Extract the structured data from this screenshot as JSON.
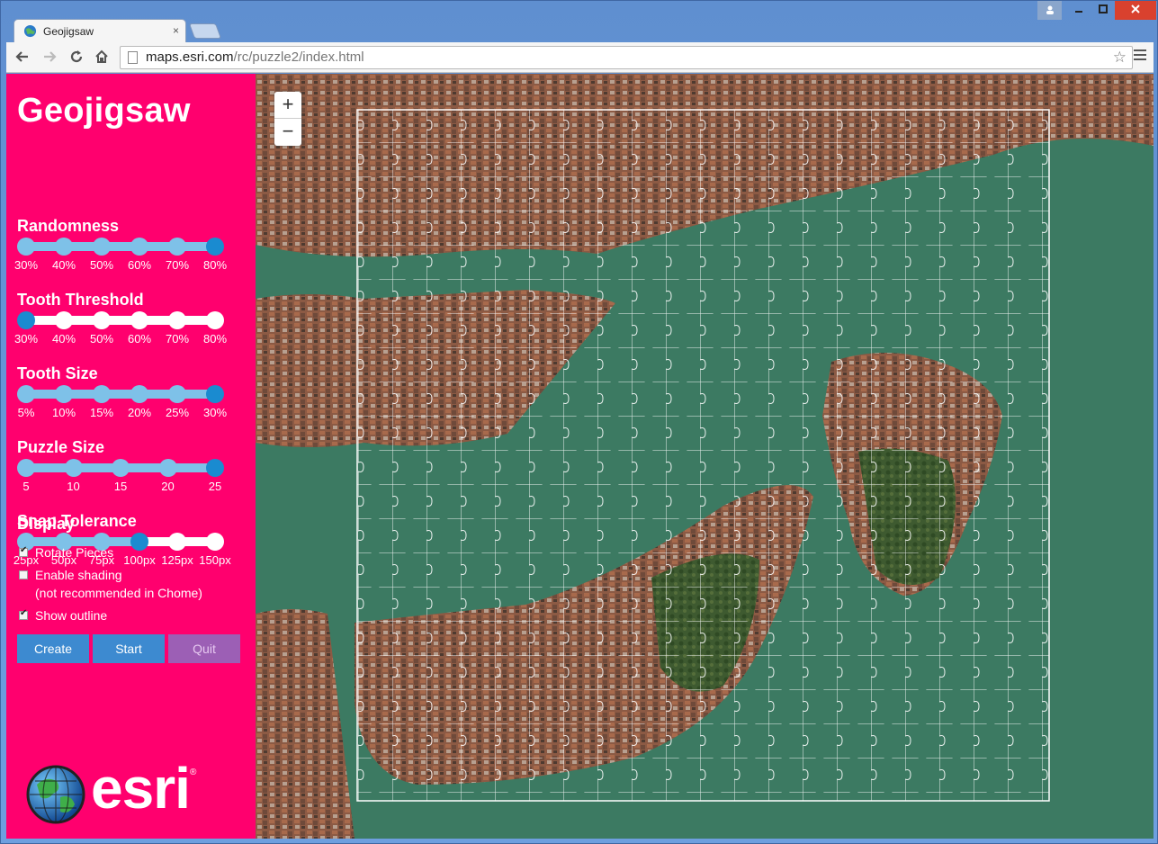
{
  "browser": {
    "tab_title": "Geojigsaw",
    "tab_close": "×",
    "url_host": "maps.esri.com",
    "url_path": "/rc/puzzle2/index.html",
    "window_controls": [
      "minimize-icon",
      "maximize-icon",
      "close-icon"
    ],
    "close_color": "#d9412e"
  },
  "sidebar": {
    "title": "Geojigsaw",
    "bg_color": "#ff006e",
    "sliders": [
      {
        "label": "Randomness",
        "ticks": [
          "30%",
          "40%",
          "50%",
          "60%",
          "70%",
          "80%"
        ],
        "selected": 5,
        "fill": true
      },
      {
        "label": "Tooth Threshold",
        "ticks": [
          "30%",
          "40%",
          "50%",
          "60%",
          "70%",
          "80%"
        ],
        "selected": 0,
        "fill": true
      },
      {
        "label": "Tooth Size",
        "ticks": [
          "5%",
          "10%",
          "15%",
          "20%",
          "25%",
          "30%"
        ],
        "selected": 5,
        "fill": true
      },
      {
        "label": "Puzzle Size",
        "ticks": [
          "5",
          "10",
          "15",
          "20",
          "25"
        ],
        "selected": 4,
        "fill": true
      },
      {
        "label": "Snap Tolerance",
        "ticks": [
          "25px",
          "50px",
          "75px",
          "100px",
          "125px",
          "150px"
        ],
        "selected": 3,
        "fill": true
      }
    ],
    "display_heading": "Display",
    "checkboxes": [
      {
        "label": "Rotate Pieces",
        "checked": true
      },
      {
        "label": "Enable shading",
        "note": "(not recommended in Chome)",
        "checked": false
      },
      {
        "label": "Show outline",
        "checked": true
      }
    ],
    "buttons": [
      {
        "label": "Create",
        "color": "#3d8ad0"
      },
      {
        "label": "Start",
        "color": "#3d8ad0"
      },
      {
        "label": "Quit",
        "color": "#9c5fb5"
      }
    ],
    "logo_text": "esri",
    "logo_reg": "®"
  },
  "map": {
    "zoom_in": "+",
    "zoom_out": "−",
    "water_color": "#3c7a62",
    "land_color": "#8a5a44"
  }
}
